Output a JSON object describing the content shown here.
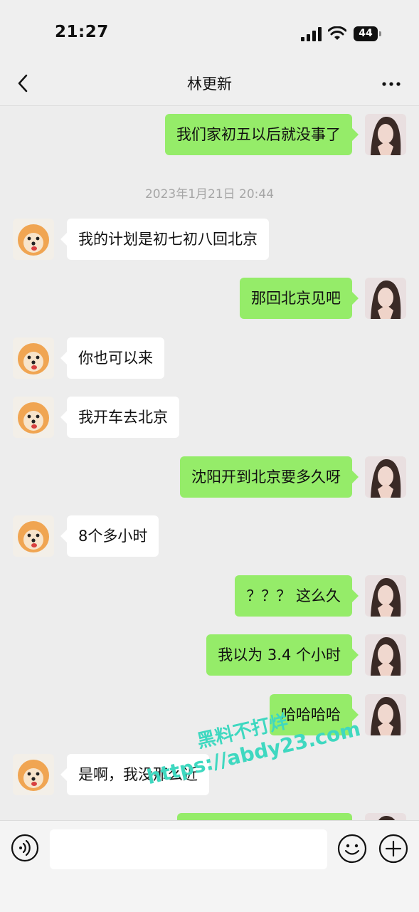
{
  "status_bar": {
    "time": "21:27",
    "battery": "44"
  },
  "nav": {
    "title": "林更新"
  },
  "chat": {
    "timestamp": "2023年1月21日 20:44",
    "messages": [
      {
        "side": "self",
        "text": "我们家初五以后就没事了"
      },
      {
        "side": "other",
        "text": "我的计划是初七初八回北京"
      },
      {
        "side": "self",
        "text": "那回北京见吧"
      },
      {
        "side": "other",
        "text": "你也可以来"
      },
      {
        "side": "other",
        "text": "我开车去北京"
      },
      {
        "side": "self",
        "text": "沈阳开到北京要多久呀"
      },
      {
        "side": "other",
        "text": "8个多小时"
      },
      {
        "side": "self",
        "text": "？？？ 这么久"
      },
      {
        "side": "self",
        "text": "我以为 3.4 个小时"
      },
      {
        "side": "self",
        "text": "哈哈哈哈"
      },
      {
        "side": "other",
        "text": "是啊，我没那么近"
      }
    ]
  },
  "watermark": {
    "line1": "黑料不打烊",
    "line2": "https://abdy23.com"
  },
  "colors": {
    "self_bubble": "#95ec69",
    "other_bubble": "#ffffff",
    "background": "#ededed"
  },
  "icons": {
    "back": "chevron-left-icon",
    "more": "more-icon",
    "voice": "voice-icon",
    "emoji": "emoji-icon",
    "plus": "plus-icon"
  }
}
